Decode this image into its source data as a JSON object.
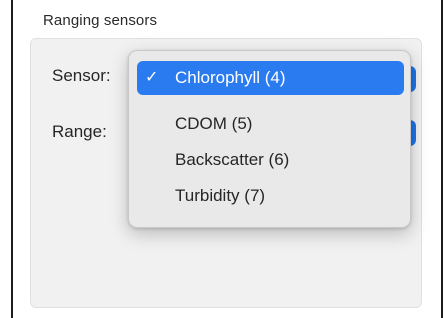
{
  "group": {
    "title": "Ranging sensors"
  },
  "fields": {
    "sensor_label": "Sensor:",
    "range_label": "Range:"
  },
  "sensor_menu": {
    "check_glyph": "✓",
    "items": [
      {
        "label": "Chlorophyll (4)",
        "selected": true
      },
      {
        "label": "CDOM (5)",
        "selected": false
      },
      {
        "label": "Backscatter (6)",
        "selected": false
      },
      {
        "label": "Turbidity (7)",
        "selected": false
      }
    ]
  },
  "colors": {
    "accent": "#1f74e8",
    "selection": "#2a7af0",
    "group_background": "#f1f1f1"
  }
}
